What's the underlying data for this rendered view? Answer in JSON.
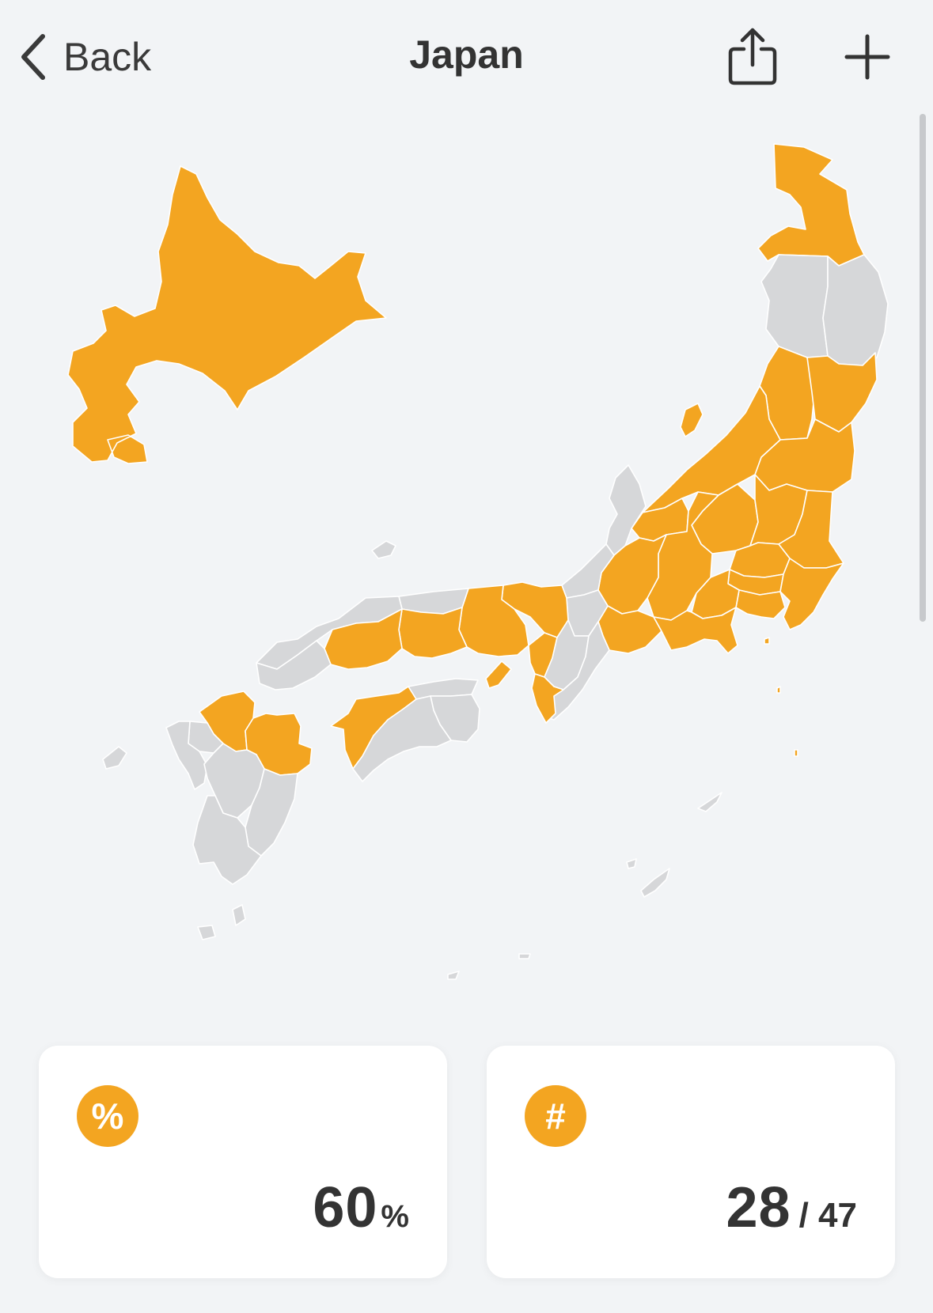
{
  "header": {
    "back_label": "Back",
    "title": "Japan"
  },
  "icons": {
    "back": "chevron-left-icon",
    "share": "share-icon",
    "add": "plus-icon"
  },
  "colors": {
    "visited": "#f3a521",
    "unvisited": "#d6d7d9",
    "background": "#f2f4f6",
    "card": "#ffffff"
  },
  "map": {
    "country": "Japan",
    "total_prefectures": 47,
    "visited_count": 28,
    "visited_regions": [
      "Hokkaido",
      "Aomori",
      "Miyagi",
      "Yamagata",
      "Fukushima",
      "Niigata",
      "Toyama",
      "Nagano",
      "Gifu",
      "Aichi",
      "Shizuoka",
      "Yamanashi",
      "Gunma",
      "Tochigi",
      "Ibaraki",
      "Saitama",
      "Tokyo",
      "Chiba",
      "Kanagawa",
      "Hyogo",
      "Osaka",
      "Kyoto",
      "Wakayama",
      "Okayama",
      "Hiroshima",
      "Ehime",
      "Fukuoka",
      "Oita"
    ],
    "unvisited_regions": [
      "Akita",
      "Iwate",
      "Ishikawa",
      "Fukui",
      "Shiga",
      "Nara",
      "Mie",
      "Tottori",
      "Shimane",
      "Yamaguchi",
      "Kagawa",
      "Tokushima",
      "Kochi",
      "Saga",
      "Nagasaki",
      "Kumamoto",
      "Miyazaki",
      "Kagoshima",
      "Okinawa"
    ]
  },
  "stats": {
    "percent": {
      "icon_glyph": "%",
      "value": "60",
      "unit": "%"
    },
    "count": {
      "icon_glyph": "#",
      "value": "28",
      "total": "/ 47"
    }
  }
}
